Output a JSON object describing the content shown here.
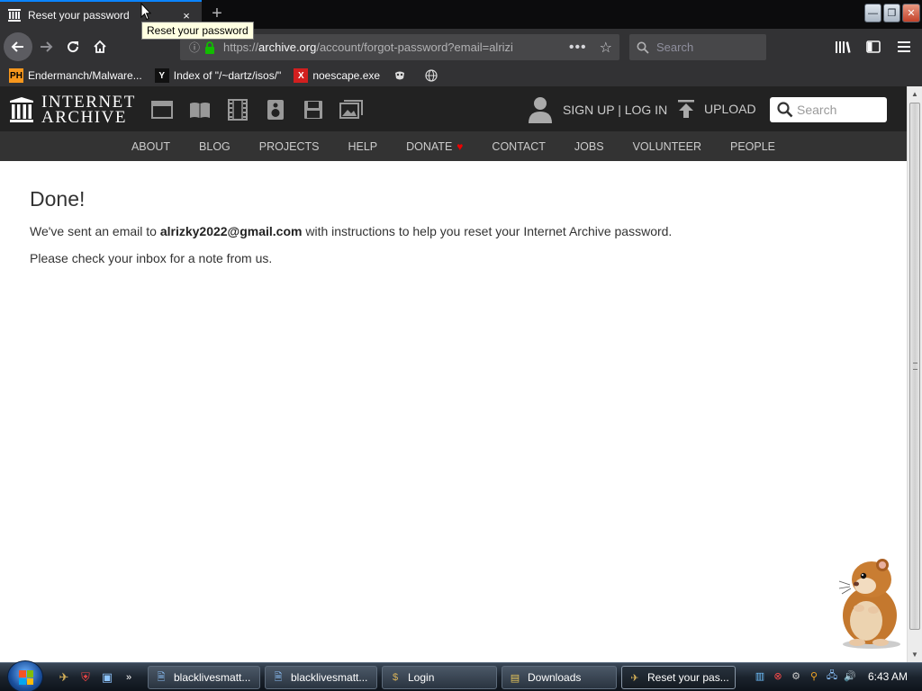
{
  "browser": {
    "tab": {
      "title": "Reset your password",
      "close": "×"
    },
    "new_tab": "+",
    "tooltip": "Reset your password",
    "window_controls": {
      "minimize": "—",
      "restore": "❐",
      "close": "✕"
    },
    "url": {
      "prefix": "https://",
      "domain": "archive.org",
      "path": "/account/forgot-password?email=alrizi",
      "more": "•••",
      "star": "☆"
    },
    "search_placeholder": "Search",
    "bookmarks": [
      {
        "label": "Endermanch/Malware...",
        "icon": "PH"
      },
      {
        "label": "Index of \"/~dartz/isos/\"",
        "icon": "Y"
      },
      {
        "label": "noescape.exe",
        "icon": "X"
      },
      {
        "label": "",
        "icon": "mask-icon"
      },
      {
        "label": "",
        "icon": "globe-icon"
      }
    ]
  },
  "archive": {
    "logo_line1": "INTERNET",
    "logo_line2": "ARCHIVE",
    "user_label": "SIGN UP | LOG IN",
    "upload_label": "UPLOAD",
    "search_placeholder": "Search",
    "nav": [
      "ABOUT",
      "BLOG",
      "PROJECTS",
      "HELP",
      "DONATE",
      "CONTACT",
      "JOBS",
      "VOLUNTEER",
      "PEOPLE"
    ],
    "donate_heart": "♥"
  },
  "content": {
    "heading": "Done!",
    "p1_before": "We've sent an email to ",
    "email": "alrizky2022@gmail.com",
    "p1_after": " with instructions to help you reset your Internet Archive password.",
    "p2": "Please check your inbox for a note from us."
  },
  "taskbar": {
    "buttons": [
      {
        "label": "blacklivesmatt..."
      },
      {
        "label": "blacklivesmatt..."
      },
      {
        "label": "Login"
      },
      {
        "label": "Downloads"
      },
      {
        "label": "Reset your pas..."
      }
    ],
    "clock": "6:43 AM",
    "chevron": "»"
  },
  "colors": {
    "firefox_dark": "#323234",
    "tab_accent": "#0a84ff",
    "ia_header": "#222222",
    "ia_nav": "#333333",
    "donate_heart": "#ee0000"
  }
}
